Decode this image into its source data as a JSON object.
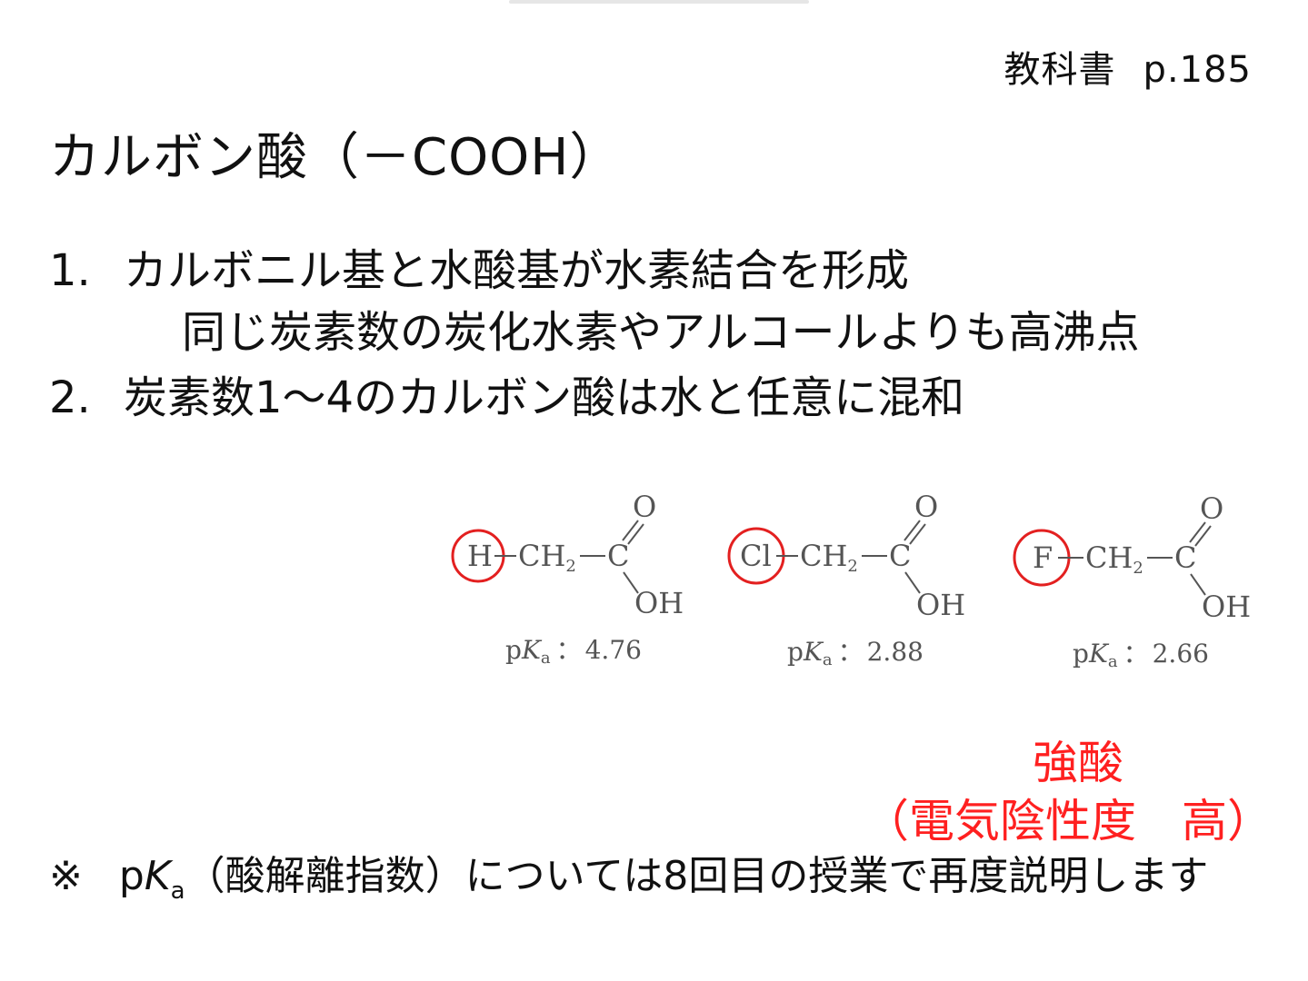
{
  "textbook": {
    "label": "教科書",
    "page": "p.185"
  },
  "title": "カルボン酸（－COOH）",
  "items": [
    {
      "num": "1.",
      "text": "カルボニル基と水酸基が水素結合を形成",
      "sub": "同じ炭素数の炭化水素やアルコールよりも高沸点"
    },
    {
      "num": "2.",
      "text": "炭素数1～4のカルボン酸は水と任意に混和"
    }
  ],
  "molecules": [
    {
      "substituent": "H",
      "ch2": "CH",
      "ch2_sub": "2",
      "carbon": "C",
      "oxygen": "O",
      "hydroxyl": "OH",
      "pka_label": "p",
      "pka_k": "K",
      "pka_a": "a",
      "pka_sep": "：",
      "pka_value": "4.76"
    },
    {
      "substituent": "Cl",
      "ch2": "CH",
      "ch2_sub": "2",
      "carbon": "C",
      "oxygen": "O",
      "hydroxyl": "OH",
      "pka_label": "p",
      "pka_k": "K",
      "pka_a": "a",
      "pka_sep": "：",
      "pka_value": "2.88"
    },
    {
      "substituent": "F",
      "ch2": "CH",
      "ch2_sub": "2",
      "carbon": "C",
      "oxygen": "O",
      "hydroxyl": "OH",
      "pka_label": "p",
      "pka_k": "K",
      "pka_a": "a",
      "pka_sep": "：",
      "pka_value": "2.66"
    }
  ],
  "annotation": {
    "strong_acid": "強酸",
    "electronegativity": "（電気陰性度　高）",
    "color": "#ff2020"
  },
  "note": {
    "mark": "※",
    "p": "p",
    "k": "K",
    "a": "a",
    "text": "（酸解離指数）については8回目の授業で再度説明します"
  }
}
